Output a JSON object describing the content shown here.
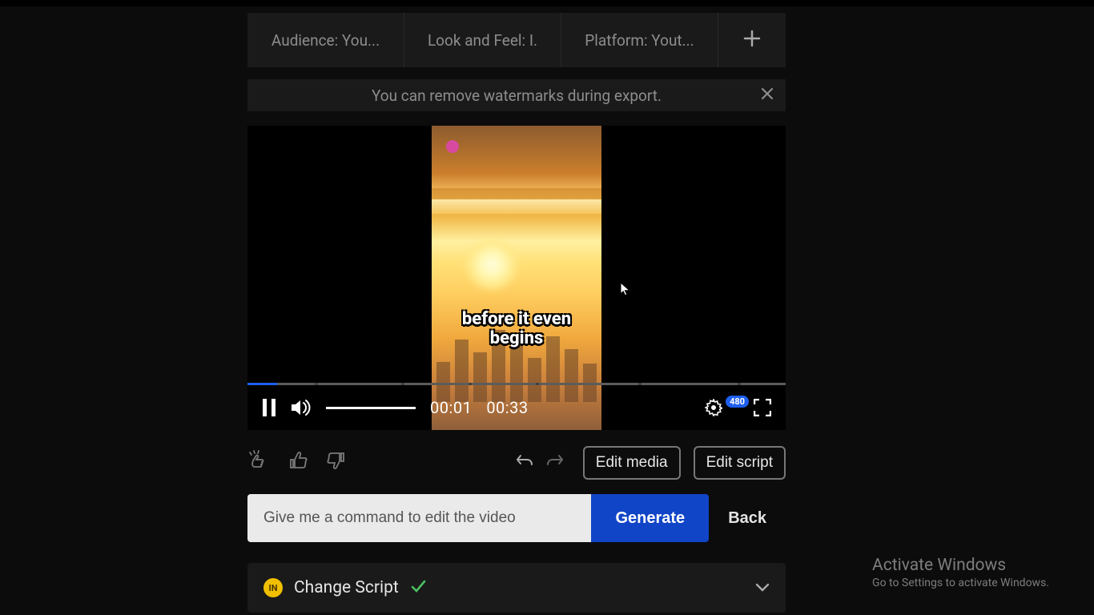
{
  "tags": {
    "audience": "Audience: You...",
    "look": "Look and Feel: I.",
    "platform": "Platform: Yout..."
  },
  "notice": {
    "text": "You can remove watermarks during export."
  },
  "video": {
    "subtitle": "before it even begins",
    "current_time": "00:01",
    "total_time": "00:33",
    "quality": "480"
  },
  "edit": {
    "media": "Edit media",
    "script": "Edit script"
  },
  "command": {
    "placeholder": "Give me a command to edit the video",
    "generate": "Generate",
    "back": "Back"
  },
  "card": {
    "avatar_initials": "IN",
    "label": "Change Script"
  },
  "activation": {
    "line1": "Activate Windows",
    "line2": "Go to Settings to activate Windows."
  }
}
